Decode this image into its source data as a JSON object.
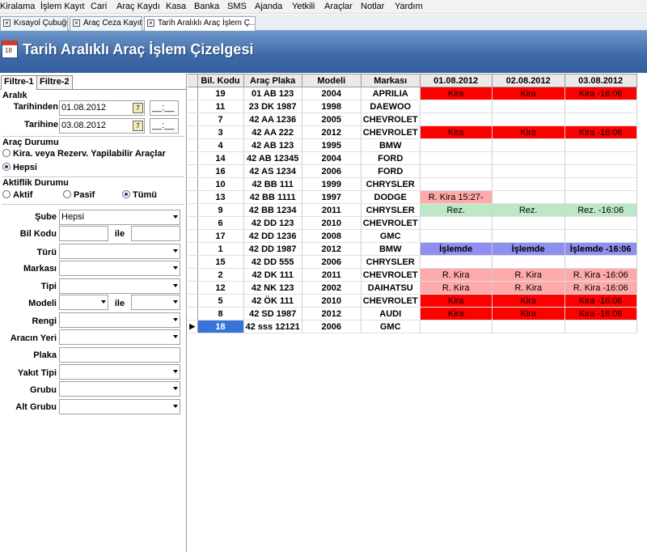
{
  "menu": [
    "Kiralama",
    "İşlem Kayıt",
    "Cari",
    "Araç Kaydı",
    "Kasa",
    "Banka",
    "SMS",
    "Ajanda",
    "Yetkili",
    "Araçlar",
    "Notlar",
    "Yardım"
  ],
  "tabs": [
    "Kısayol Çubuğu",
    "Araç Ceza Kayıt",
    "Tarih Aralıklı Araç İşlem Ç..."
  ],
  "banner": {
    "title": "Tarih Aralıklı Araç İşlem Çizelgesi",
    "icon_text": "18"
  },
  "filter_tabs": [
    "Filtre-1",
    "Filtre-2"
  ],
  "range": {
    "group": "Aralık",
    "from_label": "Tarihinden",
    "from_date": "01.08.2012",
    "from_time": "__:__",
    "to_label": "Tarihine",
    "to_date": "03.08.2012",
    "to_time": "__:__",
    "cal_icon": "7"
  },
  "vehicle_status": {
    "group": "Araç Durumu",
    "opt1": "Kira. veya Rezerv. Yapilabilir Araçlar",
    "opt2": "Hepsi"
  },
  "active_status": {
    "group": "Aktiflik Durumu",
    "opt1": "Aktif",
    "opt2": "Pasif",
    "opt3": "Tümü"
  },
  "fields": {
    "sube": "Şube",
    "sube_value": "Hepsi",
    "bil_kodu": "Bil Kodu",
    "ile": "ile",
    "turu": "Türü",
    "markasi": "Markası",
    "tipi": "Tipi",
    "modeli": "Modeli",
    "rengi": "Rengi",
    "aracin_yeri": "Aracın Yeri",
    "plaka": "Plaka",
    "yakit_tipi": "Yakıt Tipi",
    "grubu": "Grubu",
    "alt_grubu": "Alt Grubu"
  },
  "table": {
    "columns": [
      "Bil. Kodu",
      "Araç Plaka",
      "Modeli",
      "Markası",
      "01.08.2012",
      "02.08.2012",
      "03.08.2012"
    ],
    "rows": [
      {
        "code": "19",
        "plate": "01 AB 123",
        "model": "2004",
        "brand": "APRILIA",
        "d": [
          [
            "Kira",
            "kira"
          ],
          [
            "Kira",
            "kira"
          ],
          [
            "Kira -16:06",
            "kira"
          ]
        ]
      },
      {
        "code": "11",
        "plate": "23 DK 1987",
        "model": "1998",
        "brand": "DAEWOO",
        "d": [
          [
            "",
            ""
          ],
          [
            "",
            ""
          ],
          [
            "",
            ""
          ]
        ]
      },
      {
        "code": "7",
        "plate": "42 AA 1236",
        "model": "2005",
        "brand": "CHEVROLET",
        "d": [
          [
            "",
            ""
          ],
          [
            "",
            ""
          ],
          [
            "",
            ""
          ]
        ]
      },
      {
        "code": "3",
        "plate": "42 AA 222",
        "model": "2012",
        "brand": "CHEVROLET",
        "d": [
          [
            "Kira",
            "kira"
          ],
          [
            "Kira",
            "kira"
          ],
          [
            "Kira -16:06",
            "kira"
          ]
        ]
      },
      {
        "code": "4",
        "plate": "42 AB 123",
        "model": "1995",
        "brand": "BMW",
        "d": [
          [
            "",
            ""
          ],
          [
            "",
            ""
          ],
          [
            "",
            ""
          ]
        ]
      },
      {
        "code": "14",
        "plate": "42 AB 12345",
        "model": "2004",
        "brand": "FORD",
        "d": [
          [
            "",
            ""
          ],
          [
            "",
            ""
          ],
          [
            "",
            ""
          ]
        ]
      },
      {
        "code": "16",
        "plate": "42 AS 1234",
        "model": "2006",
        "brand": "FORD",
        "d": [
          [
            "",
            ""
          ],
          [
            "",
            ""
          ],
          [
            "",
            ""
          ]
        ]
      },
      {
        "code": "10",
        "plate": "42 BB 111",
        "model": "1999",
        "brand": "CHRYSLER",
        "d": [
          [
            "",
            ""
          ],
          [
            "",
            ""
          ],
          [
            "",
            ""
          ]
        ]
      },
      {
        "code": "13",
        "plate": "42 BB 1111",
        "model": "1997",
        "brand": "DODGE",
        "d": [
          [
            "R. Kira 15:27-",
            "rkira"
          ],
          [
            "",
            ""
          ],
          [
            "",
            ""
          ]
        ]
      },
      {
        "code": "9",
        "plate": "42 BB 1234",
        "model": "2011",
        "brand": "CHRYSLER",
        "d": [
          [
            "Rez.",
            "rez"
          ],
          [
            "Rez.",
            "rez"
          ],
          [
            "Rez. -16:06",
            "rez"
          ]
        ]
      },
      {
        "code": "6",
        "plate": "42 DD 123",
        "model": "2010",
        "brand": "CHEVROLET",
        "d": [
          [
            "",
            ""
          ],
          [
            "",
            ""
          ],
          [
            "",
            ""
          ]
        ]
      },
      {
        "code": "17",
        "plate": "42 DD 1236",
        "model": "2008",
        "brand": "GMC",
        "d": [
          [
            "",
            ""
          ],
          [
            "",
            ""
          ],
          [
            "",
            ""
          ]
        ]
      },
      {
        "code": "1",
        "plate": "42 DD 1987",
        "model": "2012",
        "brand": "BMW",
        "d": [
          [
            "İşlemde",
            "isl"
          ],
          [
            "İşlemde",
            "isl"
          ],
          [
            "İşlemde -16:06",
            "isl"
          ]
        ]
      },
      {
        "code": "15",
        "plate": "42 DD 555",
        "model": "2006",
        "brand": "CHRYSLER",
        "d": [
          [
            "",
            ""
          ],
          [
            "",
            ""
          ],
          [
            "",
            ""
          ]
        ]
      },
      {
        "code": "2",
        "plate": "42 DK 111",
        "model": "2011",
        "brand": "CHEVROLET",
        "d": [
          [
            "R. Kira",
            "rkira"
          ],
          [
            "R. Kira",
            "rkira"
          ],
          [
            "R. Kira -16:06",
            "rkira"
          ]
        ]
      },
      {
        "code": "12",
        "plate": "42 NK 123",
        "model": "2002",
        "brand": "DAIHATSU",
        "d": [
          [
            "R. Kira",
            "rkira"
          ],
          [
            "R. Kira",
            "rkira"
          ],
          [
            "R. Kira -16:06",
            "rkira"
          ]
        ]
      },
      {
        "code": "5",
        "plate": "42 ÖK 111",
        "model": "2010",
        "brand": "CHEVROLET",
        "d": [
          [
            "Kira",
            "kira"
          ],
          [
            "Kira",
            "kira"
          ],
          [
            "Kira -16:06",
            "kira"
          ]
        ]
      },
      {
        "code": "8",
        "plate": "42 SD 1987",
        "model": "2012",
        "brand": "AUDI",
        "d": [
          [
            "Kira",
            "kira"
          ],
          [
            "Kira",
            "kira"
          ],
          [
            "Kira -16:06",
            "kira"
          ]
        ]
      },
      {
        "code": "18",
        "plate": "42 sss 12121",
        "model": "2006",
        "brand": "GMC",
        "d": [
          [
            "",
            ""
          ],
          [
            "",
            ""
          ],
          [
            "",
            ""
          ]
        ],
        "selected": true
      }
    ]
  }
}
